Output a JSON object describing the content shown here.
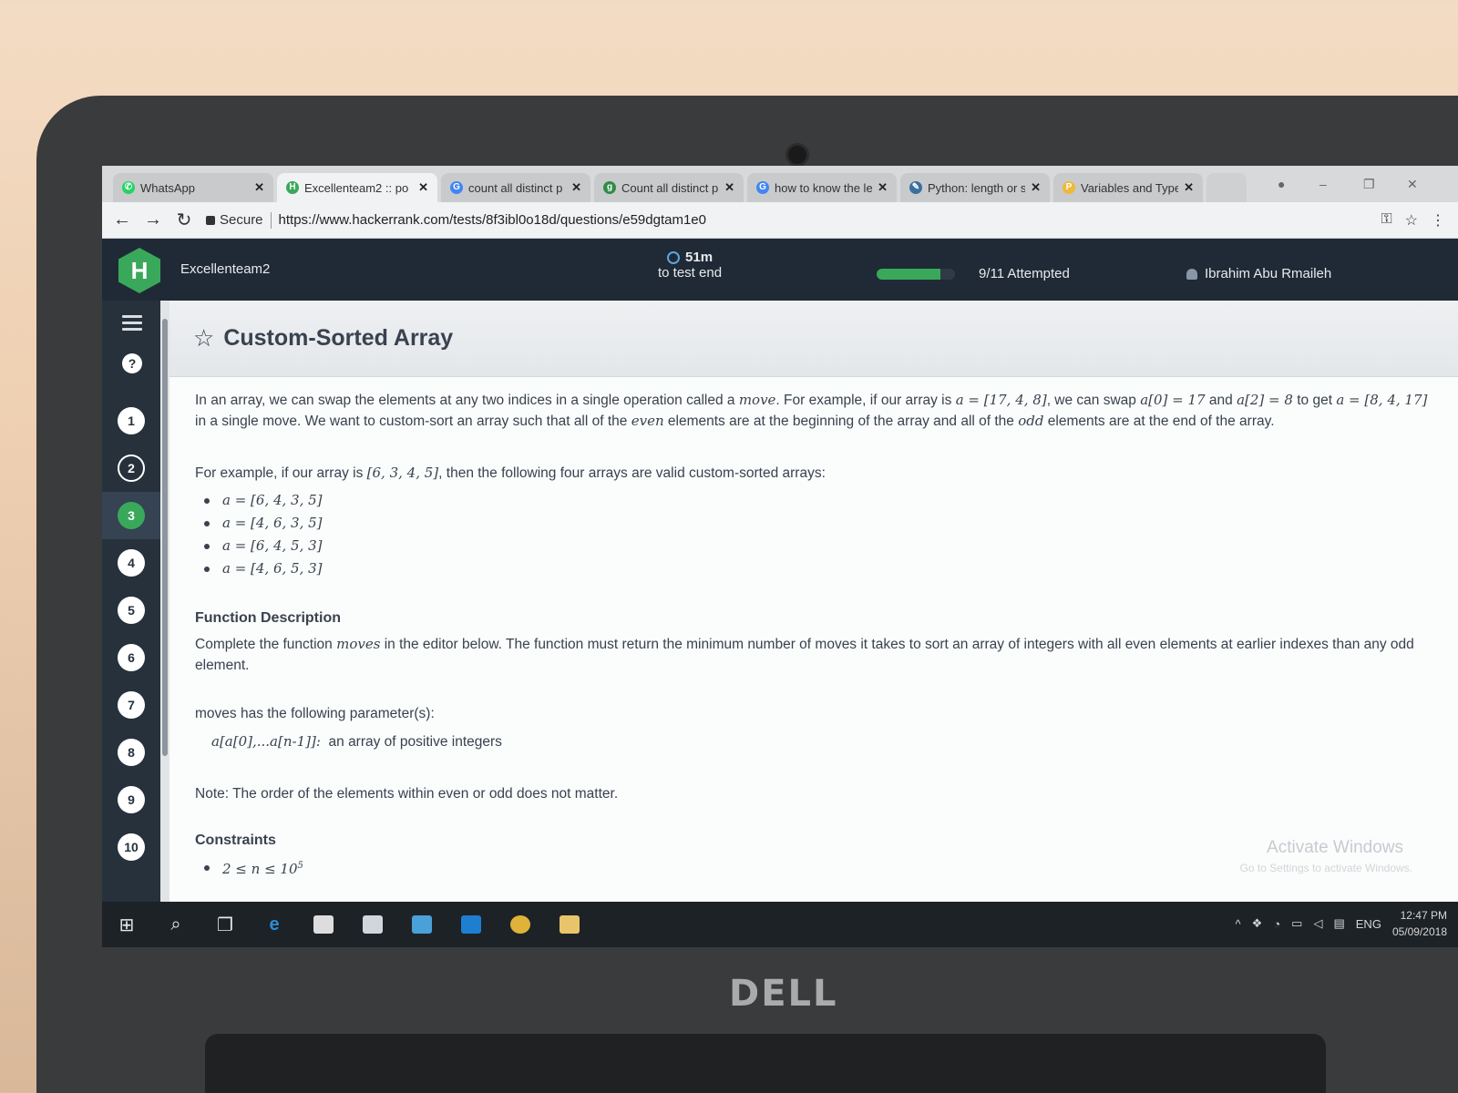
{
  "browser": {
    "tabs": [
      {
        "title": "WhatsApp",
        "icon": "whatsapp-icon",
        "color": "#25d366"
      },
      {
        "title": "Excellenteam2 :: po",
        "icon": "hackerrank-icon",
        "color": "#39a85b",
        "active": true
      },
      {
        "title": "count all distinct p",
        "icon": "google-icon",
        "color": "#4285f4"
      },
      {
        "title": "Count all distinct p",
        "icon": "geeksforgeeks-icon",
        "color": "#2f8d46"
      },
      {
        "title": "how to know the le",
        "icon": "google-icon",
        "color": "#4285f4"
      },
      {
        "title": "Python: length or s",
        "icon": "python-icon",
        "color": "#3a6f9f"
      },
      {
        "title": "Variables and Type",
        "icon": "python-icon",
        "color": "#f0b93a"
      }
    ],
    "secure_label": "Secure",
    "url": "https://www.hackerrank.com/tests/8f3ibl0o18d/questions/e59dgtam1e0"
  },
  "header": {
    "team": "Excellenteam2",
    "timer_value": "51m",
    "timer_caption": "to test end",
    "progress_fraction": 0.818,
    "attempted": "9/11 Attempted",
    "user": "Ibrahim Abu Rmaileh"
  },
  "nav": {
    "questions": [
      "1",
      "2",
      "3",
      "4",
      "5",
      "6",
      "7",
      "8",
      "9",
      "10"
    ],
    "attempted_question": "2",
    "current_question": "3"
  },
  "problem": {
    "title": "Custom-Sorted Array",
    "intro": [
      "In an array, we can swap the elements at any two indices in a single operation called a ",
      "move",
      ". For example, if our array is ",
      "a = [17, 4, 8]",
      ", we can swap ",
      "a[0] = 17",
      " and ",
      "a[2] = 8",
      " to get ",
      "a = [8, 4, 17]",
      " in a single move. We want to custom-sort an array such that all of the ",
      "even",
      " elements are at the beginning of the array and all of the ",
      "odd",
      " elements are at the end of the array."
    ],
    "example_lead": [
      "For example, if our array is ",
      "[6, 3, 4, 5]",
      ", then the following four arrays are valid custom-sorted arrays:"
    ],
    "examples": [
      "a = [6, 4, 3, 5]",
      "a = [4, 6, 3, 5]",
      "a = [6, 4, 5, 3]",
      "a = [4, 6, 5, 3]"
    ],
    "function_heading": "Function Description",
    "function_desc": [
      "Complete the function ",
      "moves",
      " in the editor below. The function must return the minimum number of moves it takes to sort an array of integers with all even elements at earlier indexes than any odd element."
    ],
    "params_lead": "moves has the following parameter(s):",
    "param_name": "a[a[0],...a[n-1]]:",
    "param_desc": "an array of positive integers",
    "note_label": "Note",
    "note_text": ": The order of the elements within even or odd does not matter.",
    "constraints_heading": "Constraints",
    "constraint_1": "2 ≤ n ≤ 10",
    "constraint_1_exp": "5"
  },
  "windows": {
    "activate_title": "Activate Windows",
    "activate_sub": "Go to Settings to activate Windows.",
    "lang": "ENG",
    "time": "12:47 PM",
    "date": "05/09/2018"
  },
  "brand": "DELL"
}
